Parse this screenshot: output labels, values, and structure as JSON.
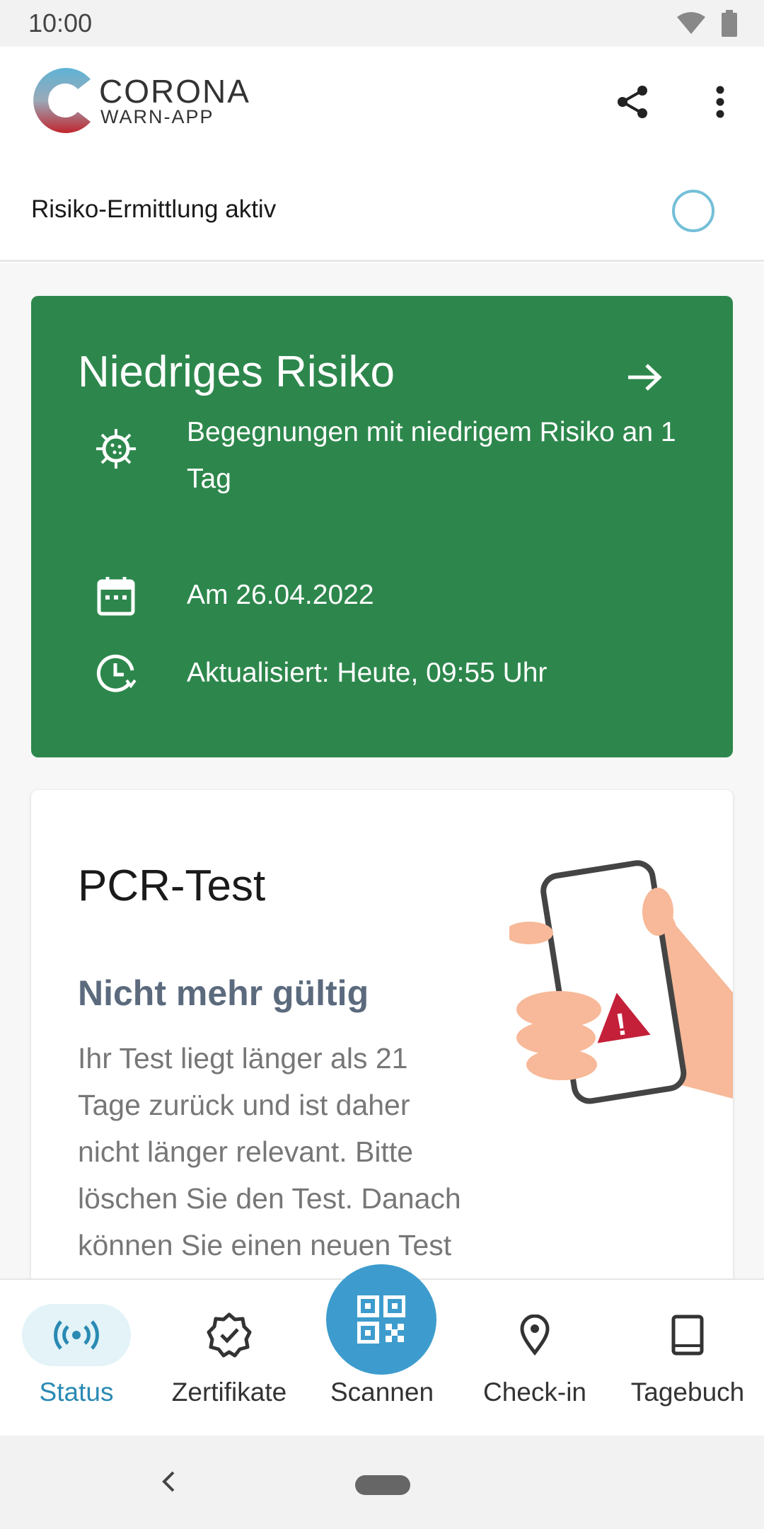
{
  "status_bar": {
    "time": "10:00",
    "wifi_icon": "wifi-icon",
    "battery_icon": "battery-icon"
  },
  "header": {
    "brand_line1": "CORONA",
    "brand_line2": "WARN-APP",
    "share_icon": "share-icon",
    "more_icon": "more-vert-icon"
  },
  "tracing": {
    "label": "Risiko-Ermittlung aktiv"
  },
  "risk_card": {
    "title": "Niedriges Risiko",
    "color": "#2d874c",
    "rows": [
      {
        "icon": "virus-icon",
        "text": "Begegnungen mit niedrigem Risiko an 1 Tag"
      },
      {
        "icon": "calendar-icon",
        "text": "Am 26.04.2022"
      },
      {
        "icon": "update-clock-icon",
        "text": "Aktualisiert: Heute, 09:55 Uhr"
      }
    ]
  },
  "test_card": {
    "title": "PCR-Test",
    "subtitle": "Nicht mehr gültig",
    "body": "Ihr Test liegt länger als 21 Tage zurück und ist daher nicht länger relevant. Bitte löschen Sie den Test. Danach können Sie einen neuen Test hinzufügen."
  },
  "bottom_nav": {
    "accent": "#2a8ab3",
    "items": [
      {
        "label": "Status",
        "icon": "broadcast-icon",
        "active": true
      },
      {
        "label": "Zertifikate",
        "icon": "certificate-check-icon",
        "active": false
      },
      {
        "label": "Scannen",
        "icon": "qr-code-icon",
        "active": false
      },
      {
        "label": "Check-in",
        "icon": "location-pin-icon",
        "active": false
      },
      {
        "label": "Tagebuch",
        "icon": "book-icon",
        "active": false
      }
    ]
  }
}
